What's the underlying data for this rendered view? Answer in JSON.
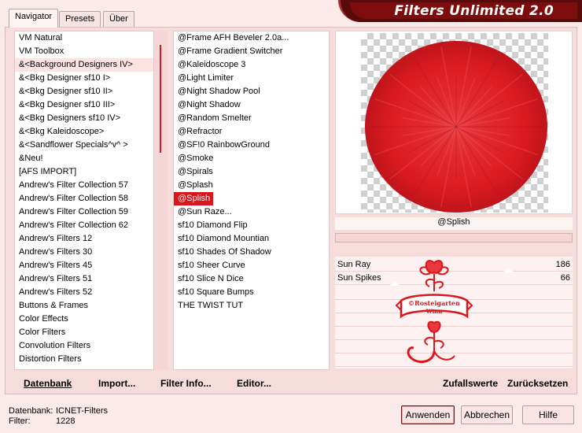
{
  "tabs": [
    {
      "label": "Navigator",
      "active": true
    },
    {
      "label": "Presets",
      "active": false
    },
    {
      "label": "Über",
      "active": false
    }
  ],
  "title": "Filters Unlimited 2.0",
  "categories": [
    "VM Natural",
    "VM Toolbox",
    "&<Background Designers IV>",
    "&<Bkg Designer sf10 I>",
    "&<Bkg Designer sf10 II>",
    "&<Bkg Designer sf10 III>",
    "&<Bkg Designers sf10 IV>",
    "&<Bkg Kaleidoscope>",
    "&<Sandflower Specials^v^ >",
    "&Neu!",
    "[AFS IMPORT]",
    "Andrew's Filter Collection 57",
    "Andrew's Filter Collection 58",
    "Andrew's Filter Collection 59",
    "Andrew's Filter Collection 62",
    "Andrew's Filters 12",
    "Andrew's Filters 30",
    "Andrew's Filters 45",
    "Andrew's Filters 51",
    "Andrew's Filters 52",
    "Buttons & Frames",
    "Color Effects",
    "Color Filters",
    "Convolution Filters",
    "Distortion Filters"
  ],
  "selected_category": "&<Background Designers IV>",
  "filters": [
    "@Frame AFH Beveler 2.0a...",
    "@Frame Gradient Switcher",
    "@Kaleidoscope 3",
    "@Light Limiter",
    "@Night Shadow Pool",
    "@Night Shadow",
    "@Random Smelter",
    "@Refractor",
    "@SF!0 RainbowGround",
    "@Smoke",
    "@Spirals",
    "@Splash",
    "@Splish",
    "@Sun Raze...",
    "sf10 Diamond Flip",
    "sf10 Diamond Mountian",
    "sf10 Shades Of Shadow",
    "sf10 Sheer Curve",
    "sf10 Slice N Dice",
    "sf10 Square Bumps",
    "THE TWIST TUT"
  ],
  "selected_filter": "@Splish",
  "preview": {
    "filter_name": "@Splish",
    "progress": 0
  },
  "parameters": [
    {
      "label": "Sun Ray",
      "value": "186"
    },
    {
      "label": "Sun Spikes",
      "value": "66"
    }
  ],
  "stamp_text": [
    "©Rosteigarten",
    "Winn"
  ],
  "commands": {
    "database": "Datenbank",
    "import": "Import...",
    "filter_info": "Filter Info...",
    "editor": "Editor...",
    "random": "Zufallswerte",
    "reset": "Zurücksetzen"
  },
  "status": {
    "database_label": "Datenbank:",
    "database_value": "ICNET-Filters",
    "filter_label": "Filter:",
    "filter_value": "1228"
  },
  "buttons": {
    "apply": "Anwenden",
    "cancel": "Abbrechen",
    "help": "Hilfe"
  },
  "colors": {
    "accent": "#d8161c",
    "background": "#fbeaea",
    "title_bar": "#7d0d0d"
  }
}
